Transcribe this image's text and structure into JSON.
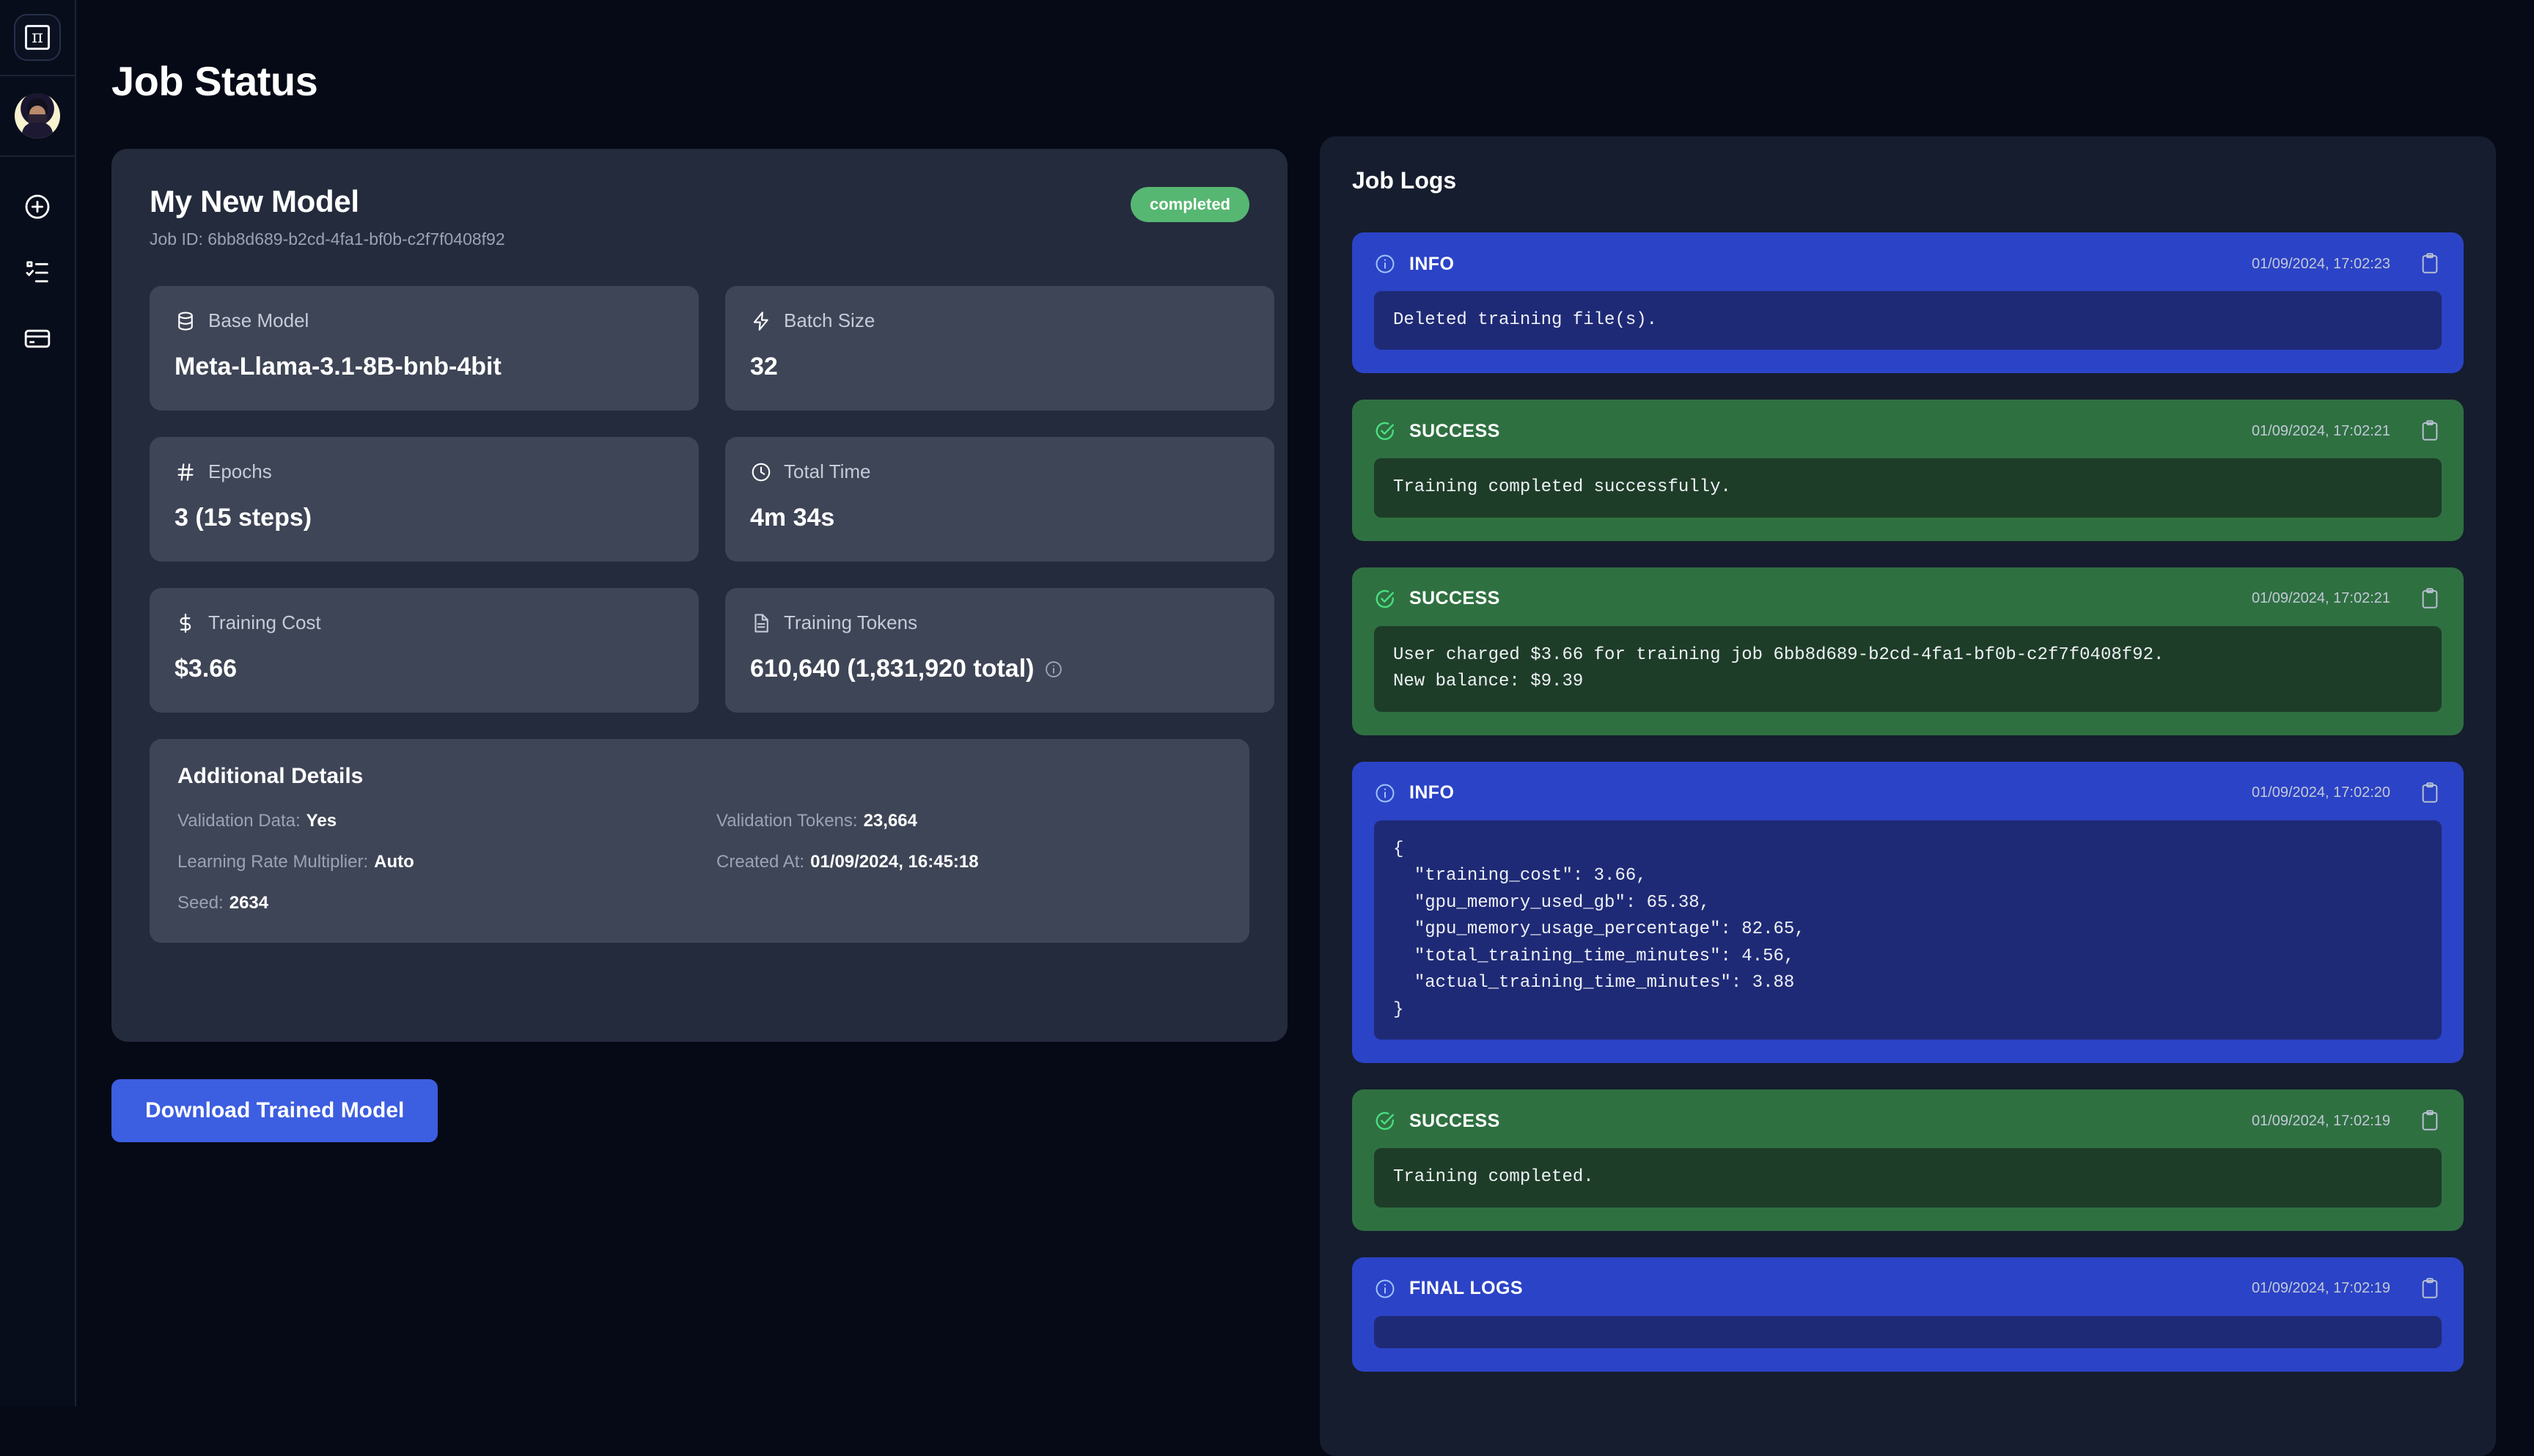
{
  "page": {
    "title": "Job Status"
  },
  "sidebar": {
    "logo": {
      "name": "pi-logo",
      "glyph": "π"
    },
    "avatar_name": "user-avatar",
    "items": [
      {
        "icon": "plus-circle-icon"
      },
      {
        "icon": "checklist-icon"
      },
      {
        "icon": "credit-card-icon"
      }
    ]
  },
  "job": {
    "model_name": "My New Model",
    "job_id_label": "Job ID:",
    "job_id": "6bb8d689-b2cd-4fa1-bf0b-c2f7f0408f92",
    "status": "completed",
    "status_color": "#56b772",
    "metrics": [
      {
        "icon": "database-icon",
        "label": "Base Model",
        "value": "Meta-Llama-3.1-8B-bnb-4bit"
      },
      {
        "icon": "bolt-icon",
        "label": "Batch Size",
        "value": "32"
      },
      {
        "icon": "hash-icon",
        "label": "Epochs",
        "value": "3 (15 steps)"
      },
      {
        "icon": "clock-icon",
        "label": "Total Time",
        "value": "4m 34s"
      },
      {
        "icon": "dollar-icon",
        "label": "Training Cost",
        "value": "$3.66"
      },
      {
        "icon": "document-icon",
        "label": "Training Tokens",
        "value": "610,640 (1,831,920 total)",
        "has_info": true
      }
    ],
    "details": {
      "heading": "Additional Details",
      "rows": [
        {
          "label": "Validation Data:",
          "value": "Yes"
        },
        {
          "label": "Validation Tokens:",
          "value": "23,664"
        },
        {
          "label": "Learning Rate Multiplier:",
          "value": "Auto"
        },
        {
          "label": "Created At:",
          "value": "01/09/2024, 16:45:18"
        },
        {
          "label": "Seed:",
          "value": "2634"
        }
      ]
    },
    "download_label": "Download Trained Model"
  },
  "logs": {
    "title": "Job Logs",
    "entries": [
      {
        "level": "INFO",
        "kind": "info",
        "icon": "info-circle-icon",
        "time": "01/09/2024, 17:02:23",
        "message": "Deleted training file(s)."
      },
      {
        "level": "SUCCESS",
        "kind": "success",
        "icon": "check-circle-icon",
        "time": "01/09/2024, 17:02:21",
        "message": "Training completed successfully."
      },
      {
        "level": "SUCCESS",
        "kind": "success",
        "icon": "check-circle-icon",
        "time": "01/09/2024, 17:02:21",
        "message": "User charged $3.66 for training job 6bb8d689-b2cd-4fa1-bf0b-c2f7f0408f92.\nNew balance: $9.39"
      },
      {
        "level": "INFO",
        "kind": "info",
        "icon": "info-circle-icon",
        "time": "01/09/2024, 17:02:20",
        "message": "{\n  \"training_cost\": 3.66,\n  \"gpu_memory_used_gb\": 65.38,\n  \"gpu_memory_usage_percentage\": 82.65,\n  \"total_training_time_minutes\": 4.56,\n  \"actual_training_time_minutes\": 3.88\n}"
      },
      {
        "level": "SUCCESS",
        "kind": "success",
        "icon": "check-circle-icon",
        "time": "01/09/2024, 17:02:19",
        "message": "Training completed."
      },
      {
        "level": "FINAL LOGS",
        "kind": "info",
        "icon": "info-circle-icon",
        "time": "01/09/2024, 17:02:19",
        "message": ""
      }
    ]
  }
}
